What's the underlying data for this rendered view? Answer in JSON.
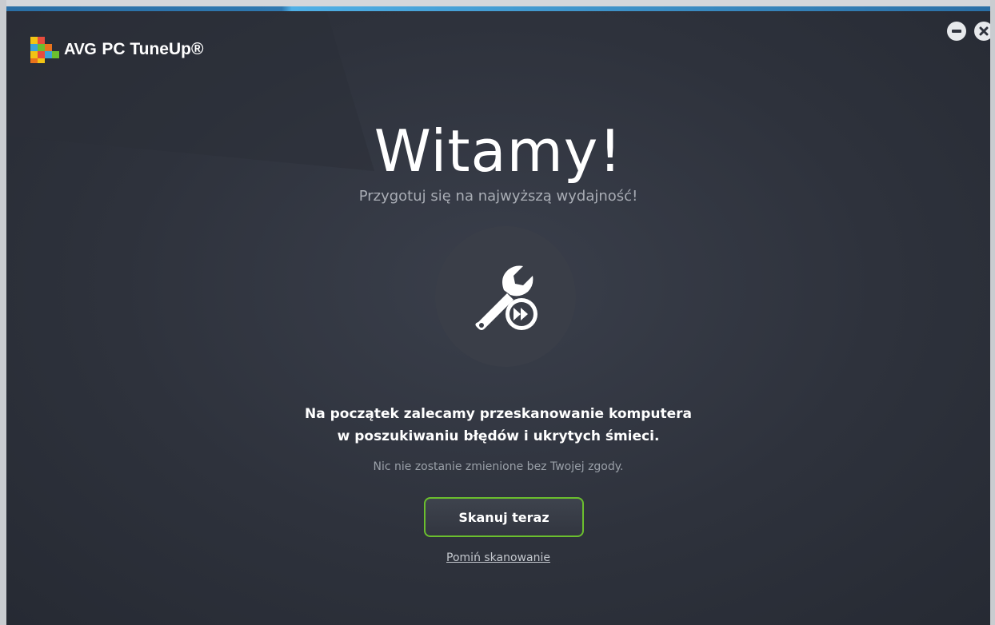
{
  "app": {
    "brand": "AVG",
    "product": "PC TuneUp®"
  },
  "window_controls": {
    "minimize_icon": "minus-circle-icon",
    "close_icon": "close-circle-icon"
  },
  "welcome": {
    "title": "Witamy!",
    "subtitle": "Przygotuj się na najwyższą wydajność!",
    "icon": "wrench-fast-forward-icon",
    "lead_line1": "Na początek zalecamy przeskanowanie komputera",
    "lead_line2": "w poszukiwaniu błędów i ukrytych śmieci.",
    "note": "Nic nie zostanie zmienione bez Twojej zgody.",
    "scan_button": "Skanuj teraz",
    "skip_link": "Pomiń skanowanie"
  },
  "colors": {
    "background": "#2e323c",
    "accent_blue": "#2f78b0",
    "button_border_green": "#6bbf2e",
    "text_white": "#ffffff",
    "text_muted": "#a9adb5"
  }
}
